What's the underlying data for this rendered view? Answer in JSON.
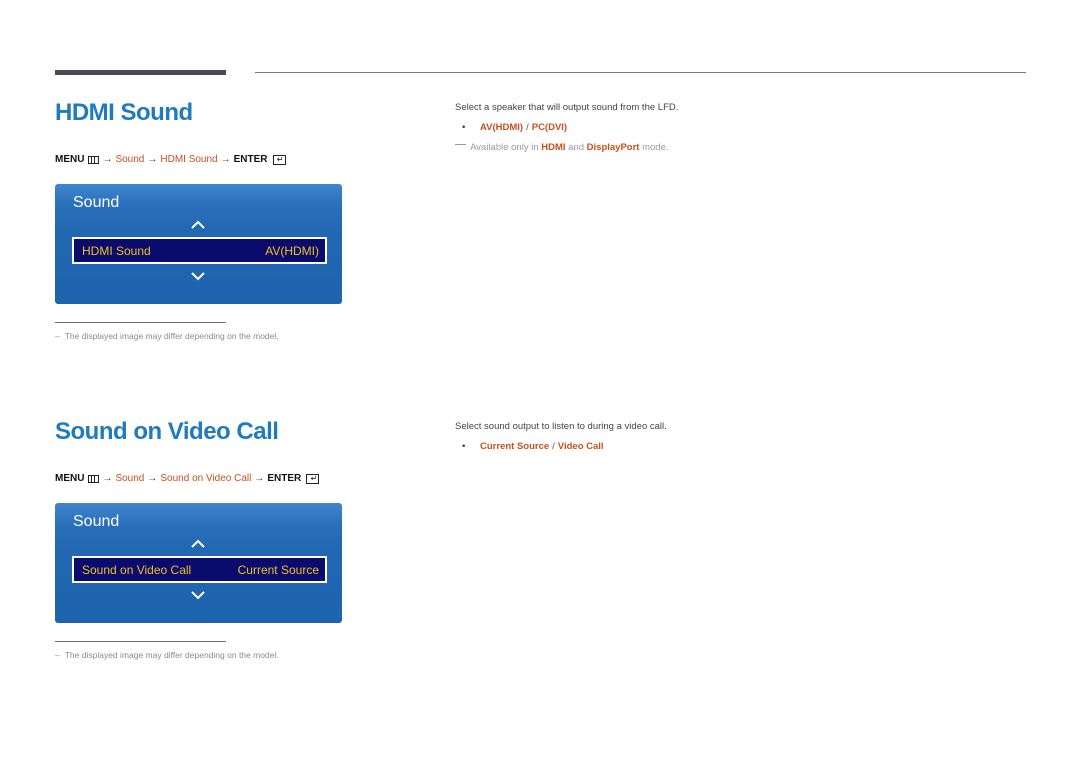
{
  "sections": [
    {
      "title": "HDMI Sound",
      "menu_path": {
        "menu": "MENU",
        "steps": [
          "Sound",
          "HDMI Sound"
        ],
        "enter": "ENTER",
        "arrow": "→"
      },
      "osd": {
        "title": "Sound",
        "item_label": "HDMI Sound",
        "item_value": "AV(HDMI)"
      },
      "footnote": "The displayed image may differ depending on the model.",
      "footnote_dash": "–",
      "description": "Select a speaker that will output sound from the LFD.",
      "options": [
        "AV(HDMI)",
        "PC(DVI)"
      ],
      "option_separator": "/",
      "bullet": "•",
      "note": {
        "prefix": "Available only in",
        "highlight1": "HDMI",
        "middle": "and",
        "highlight2": "DisplayPort",
        "suffix": "mode."
      }
    },
    {
      "title": "Sound on Video Call",
      "menu_path": {
        "menu": "MENU",
        "steps": [
          "Sound",
          "Sound on Video Call"
        ],
        "enter": "ENTER",
        "arrow": "→"
      },
      "osd": {
        "title": "Sound",
        "item_label": "Sound on Video Call",
        "item_value": "Current Source"
      },
      "footnote": "The displayed image may differ depending on the model.",
      "footnote_dash": "–",
      "description": "Select sound output to listen to during a video call.",
      "options": [
        "Current Source",
        "Video Call"
      ],
      "option_separator": "/",
      "bullet": "•"
    }
  ],
  "colors": {
    "title_blue": "#1f7bbf",
    "accent_orange": "#c8501e",
    "osd_blue": "#2167b2",
    "osd_row": "#0b0b6e",
    "osd_text": "#f0c020"
  }
}
